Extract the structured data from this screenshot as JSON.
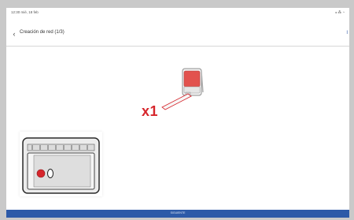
{
  "status_bar": {
    "left_text": "12:30 mié, 18 feb",
    "right_text": "⁎ ⁂ ◔"
  },
  "header": {
    "title": "Creación de red (1/3)",
    "back_icon": "chevron-left-icon",
    "right_action": "I"
  },
  "instruction": {
    "quantity_label": "x1"
  },
  "footer": {
    "button_label": "SIGUIENTE"
  },
  "colors": {
    "accent_blue": "#2d5aa8",
    "device_red": "#d6262c",
    "sensor_red": "#e2524e"
  }
}
